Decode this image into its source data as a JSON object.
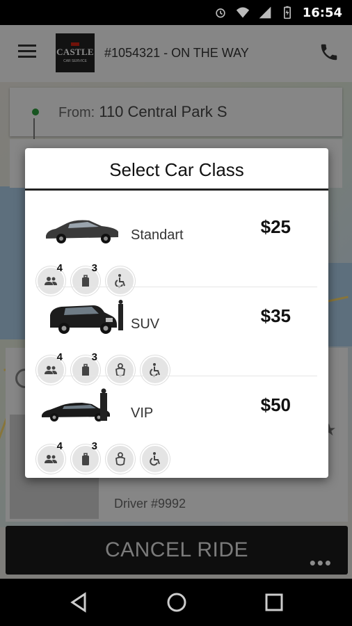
{
  "status_bar": {
    "time": "16:54"
  },
  "header": {
    "ride_title": "#1054321 - ON THE WAY",
    "logo_text": "CASTLE",
    "logo_subtext": "CAR SERVICE"
  },
  "route": {
    "from_prefix": "From:",
    "from_address": "110 Central Park S"
  },
  "driver": {
    "label": "Driver #9992"
  },
  "footer": {
    "cancel_label": "CANCEL RIDE",
    "more_label": "•••"
  },
  "dialog": {
    "title": "Select Car Class",
    "classes": [
      {
        "name": "Standart",
        "price": "$25",
        "passengers": "4",
        "luggage": "3",
        "child_seat": false,
        "wheelchair": true
      },
      {
        "name": "SUV",
        "price": "$35",
        "passengers": "4",
        "luggage": "3",
        "child_seat": true,
        "wheelchair": true
      },
      {
        "name": "VIP",
        "price": "$50",
        "passengers": "4",
        "luggage": "3",
        "child_seat": true,
        "wheelchair": true
      }
    ]
  },
  "icons": {
    "menu": "hamburger-icon",
    "call": "phone-icon",
    "passengers": "people-icon",
    "luggage": "luggage-icon",
    "child_seat": "baby-seat-icon",
    "wheelchair": "wheelchair-icon",
    "nav_back": "back-triangle-icon",
    "nav_home": "home-circle-icon",
    "nav_recents": "recents-square-icon"
  },
  "colors": {
    "accent_green": "#2b9a3b",
    "logo_red": "#cc2211",
    "dark": "#1a1a1a"
  }
}
